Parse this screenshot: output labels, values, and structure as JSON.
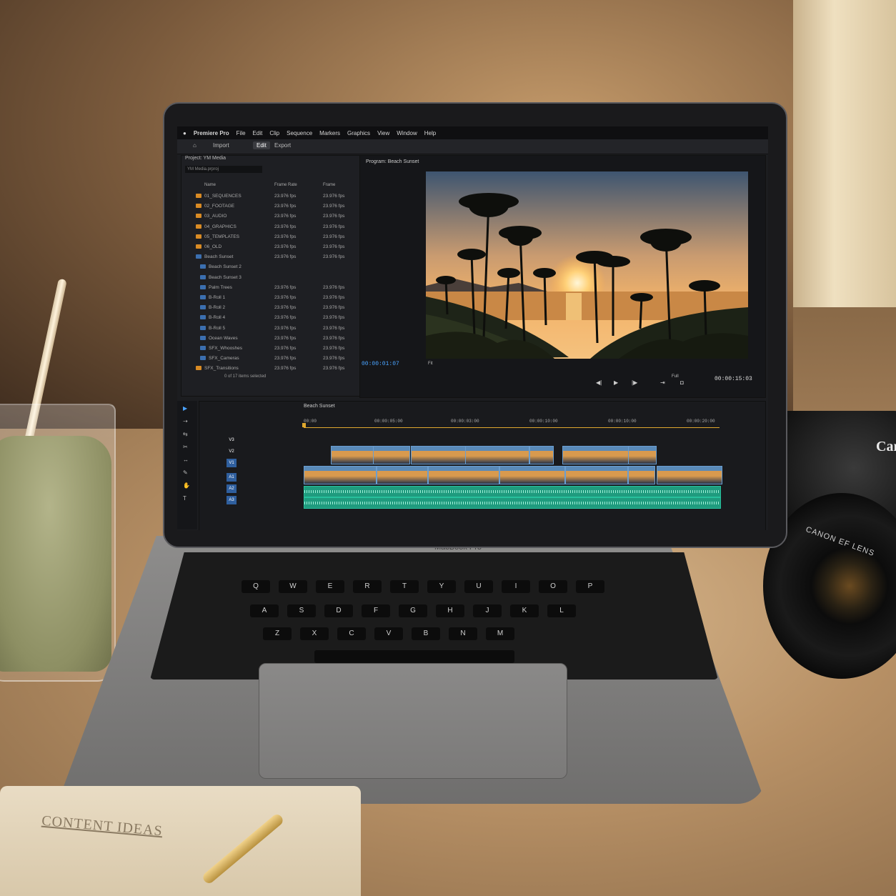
{
  "app": {
    "name": "Premiere Pro",
    "menus": [
      "File",
      "Edit",
      "Clip",
      "Sequence",
      "Markers",
      "Graphics",
      "View",
      "Window",
      "Help"
    ],
    "workspace_tabs": [
      "Import",
      "Edit",
      "Export"
    ]
  },
  "project_panel": {
    "title": "Project: YM Media",
    "search_placeholder": "YM Media.prproj",
    "columns": [
      "Name",
      "Frame Rate",
      "Frame"
    ],
    "items": [
      {
        "name": "01_SEQUENCES",
        "type": "folder",
        "frame_rate": "23.976 fps",
        "frame": "23.976 fps"
      },
      {
        "name": "02_FOOTAGE",
        "type": "folder",
        "frame_rate": "23.976 fps",
        "frame": "23.976 fps"
      },
      {
        "name": "03_AUDIO",
        "type": "folder",
        "frame_rate": "23.976 fps",
        "frame": "23.976 fps"
      },
      {
        "name": "04_GRAPHICS",
        "type": "folder",
        "frame_rate": "23.976 fps",
        "frame": "23.976 fps"
      },
      {
        "name": "05_TEMPLATES",
        "type": "folder",
        "frame_rate": "23.976 fps",
        "frame": "23.976 fps"
      },
      {
        "name": "06_OLD",
        "type": "folder",
        "frame_rate": "23.976 fps",
        "frame": "23.976 fps"
      },
      {
        "name": "Beach Sunset",
        "type": "sequence",
        "frame_rate": "23.976 fps",
        "frame": "23.976 fps"
      },
      {
        "name": "Beach Sunset 2",
        "type": "clip",
        "frame_rate": "",
        "frame": ""
      },
      {
        "name": "Beach Sunset 3",
        "type": "clip",
        "frame_rate": "",
        "frame": ""
      },
      {
        "name": "Palm Trees",
        "type": "clip",
        "frame_rate": "23.976 fps",
        "frame": "23.976 fps"
      },
      {
        "name": "B-Roll 1",
        "type": "clip",
        "frame_rate": "23.976 fps",
        "frame": "23.976 fps"
      },
      {
        "name": "B-Roll 2",
        "type": "clip",
        "frame_rate": "23.976 fps",
        "frame": "23.976 fps"
      },
      {
        "name": "B-Roll 4",
        "type": "clip",
        "frame_rate": "23.976 fps",
        "frame": "23.976 fps"
      },
      {
        "name": "B-Roll 5",
        "type": "clip",
        "frame_rate": "23.976 fps",
        "frame": "23.976 fps"
      },
      {
        "name": "Ocean Waves",
        "type": "clip",
        "frame_rate": "23.976 fps",
        "frame": "23.976 fps"
      },
      {
        "name": "SFX_Whooshes",
        "type": "clip",
        "frame_rate": "23.976 fps",
        "frame": "23.976 fps"
      },
      {
        "name": "SFX_Cameras",
        "type": "clip",
        "frame_rate": "23.976 fps",
        "frame": "23.976 fps"
      },
      {
        "name": "SFX_Transitions",
        "type": "folder",
        "frame_rate": "23.976 fps",
        "frame": "23.976 fps"
      }
    ],
    "footer": "0 of 17 items selected"
  },
  "program_monitor": {
    "title": "Program: Beach Sunset",
    "current_timecode": "00:00:01:07",
    "duration_timecode": "00:00:15:03",
    "fit_left": "Fit",
    "fit_right": "Full"
  },
  "timeline": {
    "sequence_name": "Beach Sunset",
    "ruler": [
      "00:00",
      "00:00:05:00",
      "00:00:03:00",
      "00:00:10:00",
      "00:00:10:00",
      "00:00:20:00"
    ],
    "video_tracks": [
      "V3",
      "V2",
      "V1"
    ],
    "audio_tracks": [
      "A1",
      "A2",
      "A3"
    ]
  },
  "scene": {
    "laptop_label": "MacBook Pro",
    "notebook_title": "CONTENT IDEAS",
    "camera_brand": "Can",
    "lens_label": "CANON EF LENS"
  },
  "keyboard_rows": [
    [
      "Q",
      "W",
      "E",
      "R",
      "T",
      "Y",
      "U",
      "I",
      "O",
      "P"
    ],
    [
      "A",
      "S",
      "D",
      "F",
      "G",
      "H",
      "J",
      "K",
      "L"
    ],
    [
      "Z",
      "X",
      "C",
      "V",
      "B",
      "N",
      "M"
    ]
  ],
  "colors": {
    "accent_timecode": "#4aa3ff",
    "playhead": "#e0a82e",
    "audio_clip": "#1f9b7e",
    "video_clip": "#6a9ed0",
    "folder": "#d98b24"
  }
}
